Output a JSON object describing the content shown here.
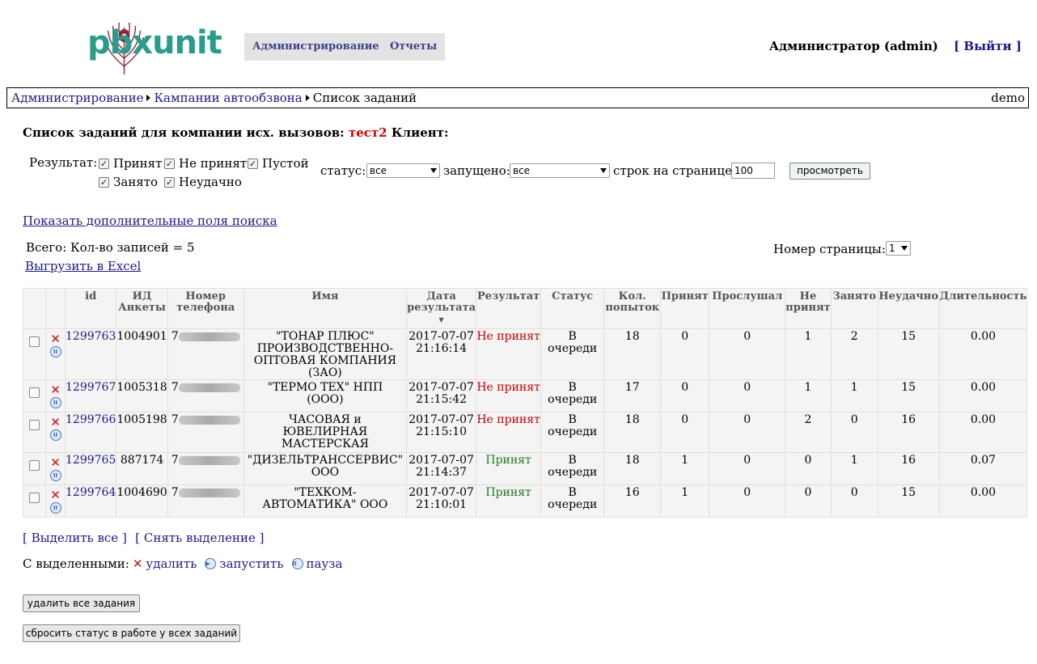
{
  "header": {
    "brand": "pbxunit",
    "nav": [
      "Администрирование",
      "Отчеты"
    ],
    "user": "Администратор (admin)",
    "logout": "[ Выйти ]"
  },
  "breadcrumb": {
    "items": [
      "Администрирование",
      "Кампании автообзвона",
      "Список заданий"
    ],
    "right": "demo"
  },
  "heading": {
    "prefix": "Список заданий для компании исх. вызовов:",
    "campaign": "тест2",
    "client": "Клиент:"
  },
  "filters": {
    "result_label": "Результат:",
    "checkboxes": [
      {
        "label": "Принят",
        "checked": true
      },
      {
        "label": "Не принят",
        "checked": true
      },
      {
        "label": "Пустой",
        "checked": true
      },
      {
        "label": "Занято",
        "checked": true
      },
      {
        "label": "Неудачно",
        "checked": true
      }
    ],
    "status_label": "статус:",
    "status_value": "все",
    "started_label": "запущено:",
    "started_value": "все",
    "rows_label": "строк на странице:",
    "rows_value": "100",
    "view_button": "просмотреть"
  },
  "extra_fields_link": "Показать дополнительные поля поиска",
  "total_text": "Всего: Кол-во записей = 5",
  "export_link": "Выгрузить в Excel",
  "page_label": "Номер страницы:",
  "page_value": "1",
  "table": {
    "headers": [
      "id",
      "ИД Анкеты",
      "Номер телефона",
      "Имя",
      "Дата результата",
      "Результат",
      "Статус",
      "Кол. попыток",
      "Принят",
      "Прослушал",
      "Не принят",
      "Занято",
      "Неудачно",
      "Длительность"
    ],
    "rows": [
      {
        "id": "1299763",
        "form_id": "1004901",
        "phone_prefix": "7",
        "name": "\"ТОНАР ПЛЮС\" ПРОИЗВОДСТВЕННО-ОПТОВАЯ КОМПАНИЯ (ЗАО)",
        "date": "2017-07-07",
        "time": "21:16:14",
        "result": "Не принят",
        "status": "В очереди",
        "attempts": "18",
        "accepted": "0",
        "listened": "0",
        "not_accepted": "1",
        "busy": "2",
        "failed": "15",
        "duration": "0.00"
      },
      {
        "id": "1299767",
        "form_id": "1005318",
        "phone_prefix": "7",
        "name": "\"ТЕРМО ТЕХ\" НПП (ООО)",
        "date": "2017-07-07",
        "time": "21:15:42",
        "result": "Не принят",
        "status": "В очереди",
        "attempts": "17",
        "accepted": "0",
        "listened": "0",
        "not_accepted": "1",
        "busy": "1",
        "failed": "15",
        "duration": "0.00"
      },
      {
        "id": "1299766",
        "form_id": "1005198",
        "phone_prefix": "7",
        "name": "ЧАСОВАЯ и ЮВЕЛИРНАЯ МАСТЕРСКАЯ",
        "date": "2017-07-07",
        "time": "21:15:10",
        "result": "Не принят",
        "status": "В очереди",
        "attempts": "18",
        "accepted": "0",
        "listened": "0",
        "not_accepted": "2",
        "busy": "0",
        "failed": "16",
        "duration": "0.00"
      },
      {
        "id": "1299765",
        "form_id": "887174",
        "phone_prefix": "7",
        "name": "\"ДИЗЕЛЬТРАНССЕРВИС\" ООО",
        "date": "2017-07-07",
        "time": "21:14:37",
        "result": "Принят",
        "status": "В очереди",
        "attempts": "18",
        "accepted": "1",
        "listened": "0",
        "not_accepted": "0",
        "busy": "1",
        "failed": "16",
        "duration": "0.07"
      },
      {
        "id": "1299764",
        "form_id": "1004690",
        "phone_prefix": "7",
        "name": "\"ТЕХКОМ-АВТОМАТИКА\" ООО",
        "date": "2017-07-07",
        "time": "21:10:01",
        "result": "Принят",
        "status": "В очереди",
        "attempts": "16",
        "accepted": "1",
        "listened": "0",
        "not_accepted": "0",
        "busy": "0",
        "failed": "15",
        "duration": "0.00"
      }
    ]
  },
  "selection": {
    "select_all": "[ Выделить все ]",
    "deselect": "[ Снять выделение ]"
  },
  "bulk": {
    "label": "С выделенными:",
    "delete": "удалить",
    "start": "запустить",
    "pause": "пауза"
  },
  "buttons": {
    "delete_all": "удалить все задания",
    "reset_status": "сбросить статус в работе у всех заданий"
  },
  "colors": {
    "brand": "#2a9c8d",
    "campaign": "#d40000",
    "rejected": "#c00000",
    "accepted": "#1c7a1c",
    "link": "#1a1a8c"
  }
}
